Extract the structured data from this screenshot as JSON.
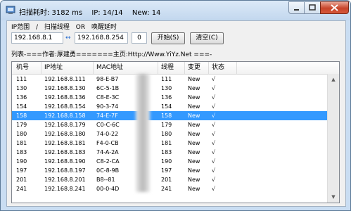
{
  "titlebar": {
    "title": "扫描耗时: 3182 ms",
    "ip_count": "IP: 14/14",
    "new_count": "New: 14"
  },
  "menu": {
    "ip_range": "IP范围",
    "sep": "/",
    "scan_threads": "扫描线程",
    "or": "OR",
    "wake_delay": "唤醒延时"
  },
  "controls": {
    "start_ip": "192.168.8.1",
    "end_ip": "192.168.8.254",
    "delay_value": "0",
    "start_button": "开始(S)",
    "clear_button": "清空(C)"
  },
  "banner": "列表-===作者:厚建勇=======主页:Http://Www.YiYz.Net ===-",
  "listview": {
    "columns": [
      "机号",
      "IP地址",
      "MAC地址",
      "线程",
      "变更",
      "状态"
    ],
    "rows": [
      [
        "111",
        "192.168.8.111",
        "98-E-B7",
        "111",
        "New",
        "√"
      ],
      [
        "130",
        "192.168.8.130",
        "6C-5-1B",
        "130",
        "New",
        "√"
      ],
      [
        "136",
        "192.168.8.136",
        "C8-E-3C",
        "136",
        "New",
        "√"
      ],
      [
        "154",
        "192.168.8.154",
        "90-3-74",
        "154",
        "New",
        "√"
      ],
      [
        "158",
        "192.168.8.158",
        "74-E-7F",
        "158",
        "New",
        "√"
      ],
      [
        "179",
        "192.168.8.179",
        "C0-C-6C",
        "179",
        "New",
        "√"
      ],
      [
        "180",
        "192.168.8.180",
        "74-0-22",
        "180",
        "New",
        "√"
      ],
      [
        "181",
        "192.168.8.181",
        "F4-0-CB",
        "181",
        "New",
        "√"
      ],
      [
        "183",
        "192.168.8.183",
        "74-A-2A",
        "183",
        "New",
        "√"
      ],
      [
        "190",
        "192.168.8.190",
        "C8-2-CA",
        "190",
        "New",
        "√"
      ],
      [
        "197",
        "192.168.8.197",
        "0C-8-9B",
        "197",
        "New",
        "√"
      ],
      [
        "201",
        "192.168.8.201",
        "B8--81",
        "201",
        "New",
        "√"
      ],
      [
        "241",
        "192.168.8.241",
        "00-0-4D",
        "241",
        "New",
        "√"
      ]
    ],
    "selected_row": 4
  }
}
